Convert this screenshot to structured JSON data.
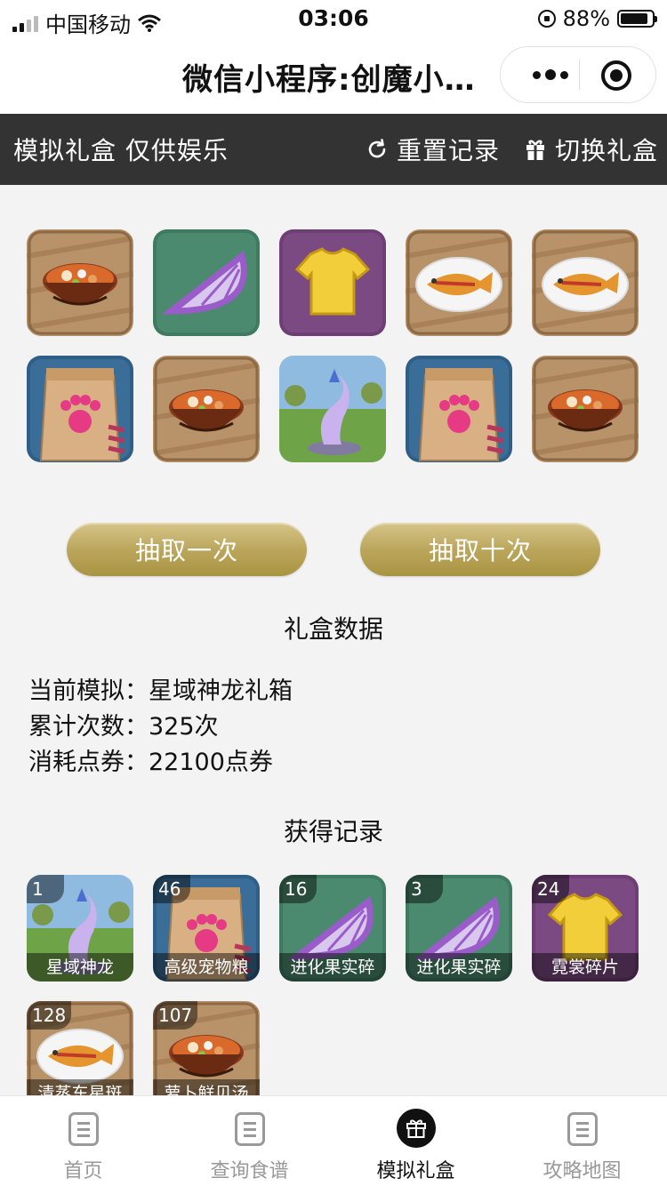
{
  "status_bar": {
    "carrier": "中国移动",
    "time": "03:06",
    "battery_percent": "88%",
    "battery_level": 0.88
  },
  "nav": {
    "title": "微信小程序:创魔小…"
  },
  "toolbar": {
    "title": "模拟礼盒 仅供娱乐",
    "reset_label": "重置记录",
    "switch_label": "切换礼盒"
  },
  "rewards": [
    {
      "icon": "soup-bowl-icon"
    },
    {
      "icon": "fruit-slice-icon"
    },
    {
      "icon": "tshirt-icon"
    },
    {
      "icon": "fish-plate-icon"
    },
    {
      "icon": "fish-plate-icon"
    },
    {
      "icon": "pet-food-bag-icon"
    },
    {
      "icon": "soup-bowl-icon"
    },
    {
      "icon": "dragon-mount-icon"
    },
    {
      "icon": "pet-food-bag-icon"
    },
    {
      "icon": "soup-bowl-icon"
    }
  ],
  "actions": {
    "draw_once": "抽取一次",
    "draw_ten": "抽取十次"
  },
  "stats": {
    "title": "礼盒数据",
    "current_label": "当前模拟：",
    "current_value": "星域神龙礼箱",
    "count_label": "累计次数：",
    "count_value": "325次",
    "cost_label": "消耗点券：",
    "cost_value": "22100点券"
  },
  "records": {
    "title": "获得记录",
    "items": [
      {
        "count": "1",
        "label": "星域神龙",
        "icon": "dragon-mount-icon"
      },
      {
        "count": "46",
        "label": "高级宠物粮",
        "icon": "pet-food-bag-icon"
      },
      {
        "count": "16",
        "label": "进化果实碎",
        "icon": "fruit-slice-icon"
      },
      {
        "count": "3",
        "label": "进化果实碎",
        "icon": "fruit-slice-icon"
      },
      {
        "count": "24",
        "label": "霓裳碎片",
        "icon": "tshirt-icon"
      },
      {
        "count": "128",
        "label": "清蒸东星斑",
        "icon": "fish-plate-icon"
      },
      {
        "count": "107",
        "label": "萝卜鲜贝汤",
        "icon": "soup-bowl-icon"
      }
    ]
  },
  "tabs": [
    {
      "label": "首页"
    },
    {
      "label": "查询食谱"
    },
    {
      "label": "模拟礼盒",
      "active": true
    },
    {
      "label": "攻略地图"
    }
  ],
  "colors": {
    "toolbar_bg": "#333333",
    "button_gold": "#bba65c",
    "page_bg": "#f3f3f3"
  }
}
